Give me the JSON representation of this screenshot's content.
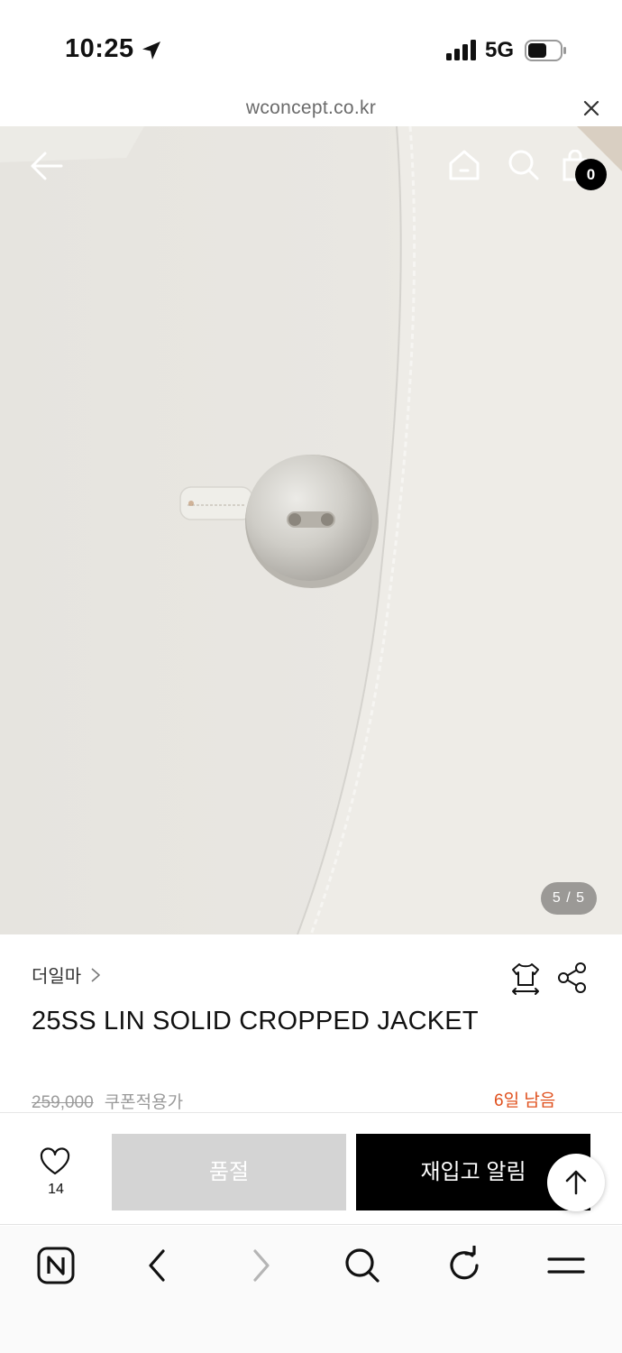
{
  "status_bar": {
    "time": "10:25",
    "network": "5G",
    "location_icon": "location-arrow-icon",
    "signal_icon": "cellular-signal-icon",
    "battery_icon": "battery-icon"
  },
  "url_bar": {
    "url": "wconcept.co.kr",
    "close_icon": "close-icon"
  },
  "header": {
    "back_icon": "back-arrow-icon",
    "home_icon": "home-icon",
    "search_icon": "search-icon",
    "cart_icon": "shopping-bag-icon",
    "cart_count": "0"
  },
  "gallery": {
    "indicator": "5 / 5",
    "current": 5,
    "total": 5
  },
  "product": {
    "brand": "더일마",
    "title": "25SS LIN SOLID CROPPED JACKET",
    "original_price": "259,000",
    "coupon_label": "쿠폰적용가",
    "remaining_label": "6일 남음"
  },
  "actions": {
    "like_count": "14",
    "soldout_label": "품절",
    "restock_label": "재입고 알림"
  },
  "colors": {
    "accent_orange": "#e0501d",
    "primary_black": "#000000",
    "disabled_gray": "#d4d4d4"
  }
}
